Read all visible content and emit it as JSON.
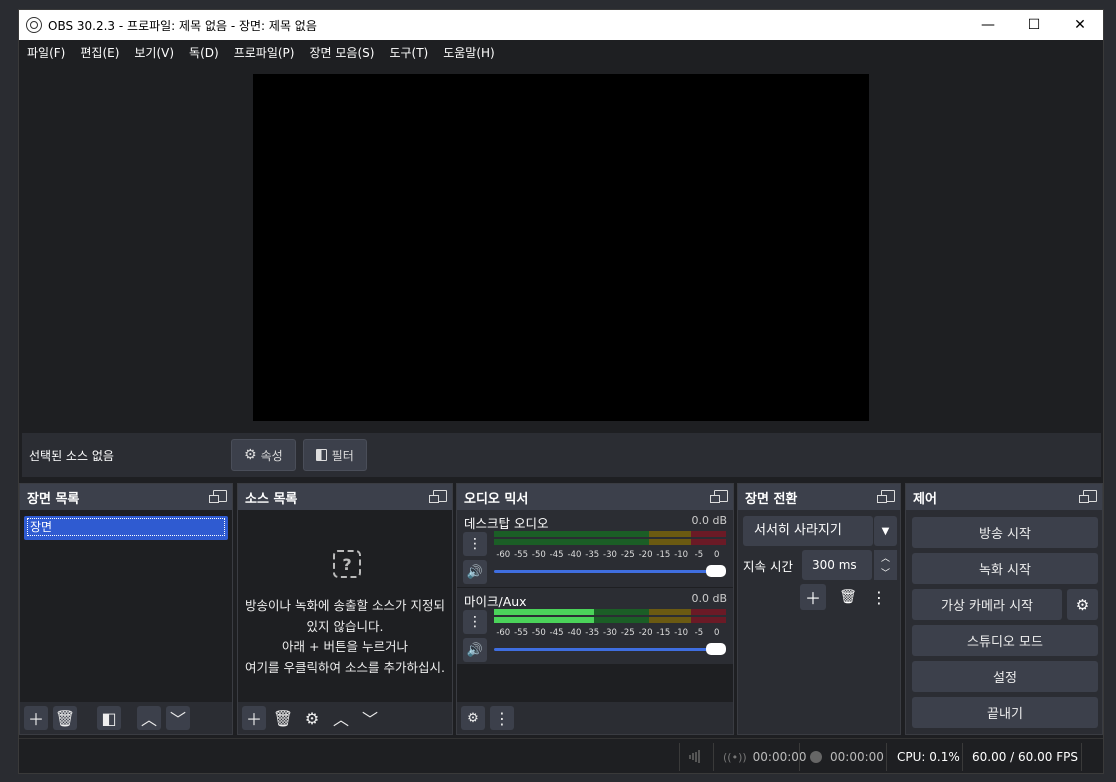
{
  "window": {
    "title": "OBS 30.2.3 - 프로파일: 제목 없음 - 장면: 제목 없음",
    "minimize": "—",
    "maximize": "☐",
    "close": "✕"
  },
  "menu": [
    "파일(F)",
    "편집(E)",
    "보기(V)",
    "독(D)",
    "프로파일(P)",
    "장면 모음(S)",
    "도구(T)",
    "도움말(H)"
  ],
  "source_bar": {
    "label": "선택된 소스 없음",
    "properties": "속성",
    "filters": "필터"
  },
  "scenes": {
    "title": "장면 목록",
    "items": [
      "장면"
    ]
  },
  "sources": {
    "title": "소스 목록",
    "hint_lines": [
      "방송이나 녹화에 송출할 소스가 지정되",
      "있지 않습니다.",
      "아래 + 버튼을 누르거나",
      "여기를 우클릭하여 소스를 추가하십시."
    ]
  },
  "mixer": {
    "title": "오디오 믹서",
    "ticks": [
      "-60",
      "-55",
      "-50",
      "-45",
      "-40",
      "-35",
      "-30",
      "-25",
      "-20",
      "-15",
      "-10",
      "-5",
      "0"
    ],
    "tracks": [
      {
        "name": "데스크탑 오디오",
        "db": "0.0 dB",
        "level": 0
      },
      {
        "name": "마이크/Aux",
        "db": "0.0 dB",
        "level": 0.43
      }
    ]
  },
  "transitions": {
    "title": "장면 전환",
    "selected": "서서히 사라지기",
    "duration_label": "지속 시간",
    "duration_value": "300 ms"
  },
  "controls": {
    "title": "제어",
    "buttons": [
      "방송 시작",
      "녹화 시작",
      "가상 카메라 시작",
      "스튜디오 모드",
      "설정",
      "끝내기"
    ]
  },
  "status": {
    "stream_time": "00:00:00",
    "rec_time": "00:00:00",
    "cpu": "CPU: 0.1%",
    "fps": "60.00 / 60.00 FPS"
  }
}
